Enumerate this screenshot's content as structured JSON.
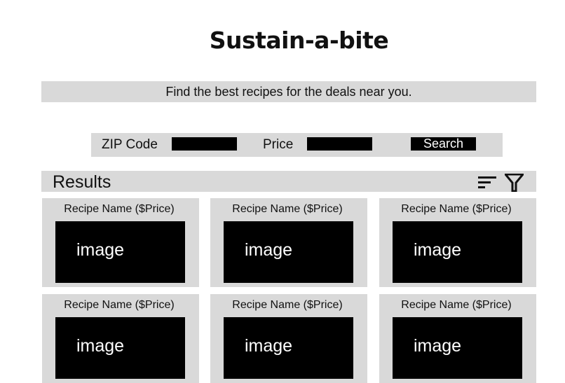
{
  "app": {
    "title": "Sustain-a-bite",
    "tagline": "Find the best recipes for the deals near you."
  },
  "search": {
    "zip_label": "ZIP Code",
    "zip_value": "",
    "price_label": "Price",
    "price_value": "",
    "button_label": "Search"
  },
  "results": {
    "title": "Results",
    "icons": [
      "sort-icon",
      "filter-icon"
    ],
    "cards": [
      {
        "name": "Recipe Name ($Price)",
        "image_label": "image"
      },
      {
        "name": "Recipe Name ($Price)",
        "image_label": "image"
      },
      {
        "name": "Recipe Name ($Price)",
        "image_label": "image"
      },
      {
        "name": "Recipe Name ($Price)",
        "image_label": "image"
      },
      {
        "name": "Recipe Name ($Price)",
        "image_label": "image"
      },
      {
        "name": "Recipe Name ($Price)",
        "image_label": "image"
      }
    ]
  },
  "colors": {
    "panel": "#d9d9d9",
    "placeholder": "#000000",
    "text": "#111111"
  }
}
